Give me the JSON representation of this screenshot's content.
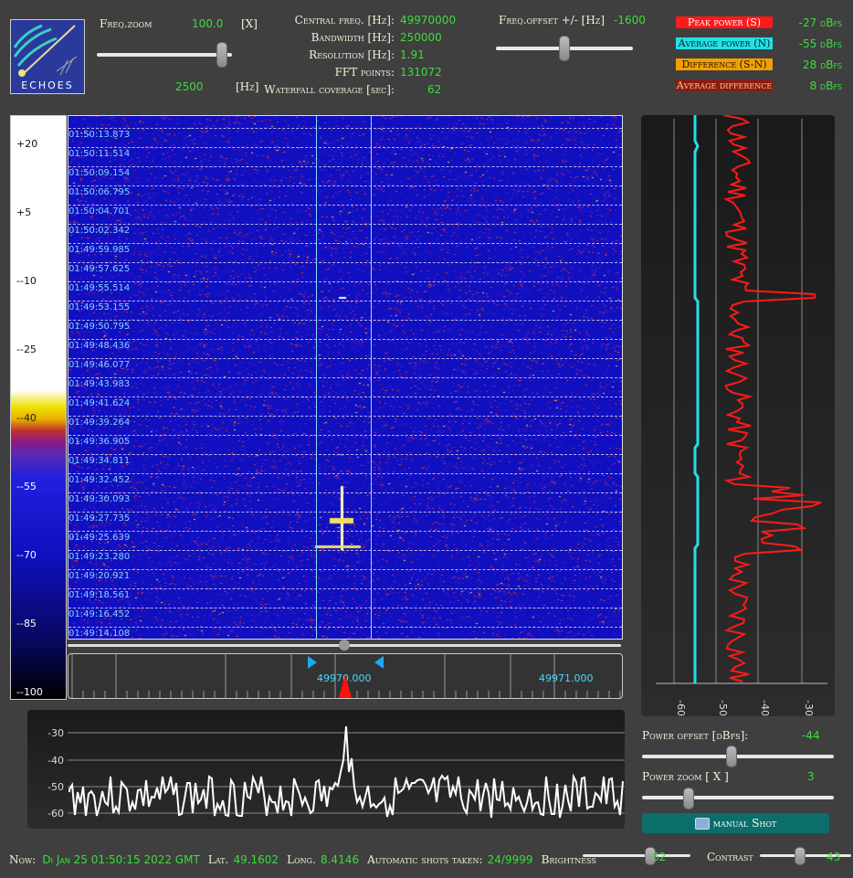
{
  "logo": {
    "text": "ECHOES"
  },
  "freq_zoom": {
    "label": "Freq.zoom",
    "value": "100.0",
    "unit": "[X]",
    "value2": "2500",
    "unit2": "[Hz]",
    "level": 0.92
  },
  "info": {
    "central_freq_label": "Central freq. [Hz]:",
    "central_freq": "49970000",
    "bandwidth_label": "Bandwidth [Hz]:",
    "bandwidth": "250000",
    "resolution_label": "Resolution [Hz]:",
    "resolution": "1.91",
    "fft_label": "FFT points:",
    "fft": "131072",
    "coverage_label": "Waterfall coverage [sec]:",
    "coverage": "62"
  },
  "freq_offset": {
    "label": "Freq.offset +/- [Hz]",
    "value": "-1600",
    "level": 0.49
  },
  "legend": {
    "peak_label": "Peak power (S)",
    "peak_value": "-27 dBfs",
    "peak_color": "#ff1a1a",
    "avg_label": "Average power (N)",
    "avg_value": "-55 dBfs",
    "avg_color": "#22e0e8",
    "diff_label": "Difference (S-N)",
    "diff_value": "28 dBfs",
    "diff_color": "#f0a000",
    "avgdiff_label": "Average difference",
    "avgdiff_value": "8 dBfs",
    "avgdiff_color": "#8a1c10"
  },
  "colorbar": {
    "labels": [
      "+20",
      "+5",
      "--10",
      "--25",
      "--40",
      "--55",
      "--70",
      "--85",
      "--100"
    ]
  },
  "waterfall": {
    "timestamps": [
      "01:50:13.873",
      "01:50:11.514",
      "01:50:09.154",
      "01:50:06.795",
      "01:50:04.701",
      "01:50:02.342",
      "01:49:59.985",
      "01:49:57.625",
      "01:49:55.514",
      "01:49:53.155",
      "01:49:50.795",
      "01:49:48.436",
      "01:49:46.077",
      "01:49:43.983",
      "01:49:41.624",
      "01:49:39.264",
      "01:49:36.905",
      "01:49:34.811",
      "01:49:32.452",
      "01:49:30.093",
      "01:49:27.735",
      "01:49:25.639",
      "01:49:23.280",
      "01:49:20.921",
      "01:49:18.561",
      "01:49:16.452",
      "01:49:14.108"
    ]
  },
  "freq_axis": {
    "left_label": "49970.000",
    "right_label": "49971.000"
  },
  "power_chart": {
    "tick_labels": [
      "-60",
      "-50",
      "-40",
      "-30"
    ]
  },
  "spectrum": {
    "tick_labels": [
      "-30",
      "-40",
      "-50",
      "-60"
    ]
  },
  "power_offset": {
    "label": "Power offset [dBfs]:",
    "value": "-44",
    "level": 0.46
  },
  "power_zoom": {
    "label": "Power zoom [ X ]",
    "value": "3",
    "level": 0.24
  },
  "manual_shot": {
    "label": "manual Shot"
  },
  "status": {
    "now_label": "Now:",
    "now": "Di Jan 25 01:50:15 2022 GMT",
    "lat_label": "Lat.",
    "lat": "49.1602",
    "long_label": "Long.",
    "long": "8.4146",
    "shots_label": "Automatic shots taken:",
    "shots": "24/9999",
    "brightness_label": "Brightness",
    "brightness": "62",
    "brightness_level": 0.62,
    "contrast_label": "Contrast",
    "contrast": "43",
    "contrast_level": 0.43
  }
}
